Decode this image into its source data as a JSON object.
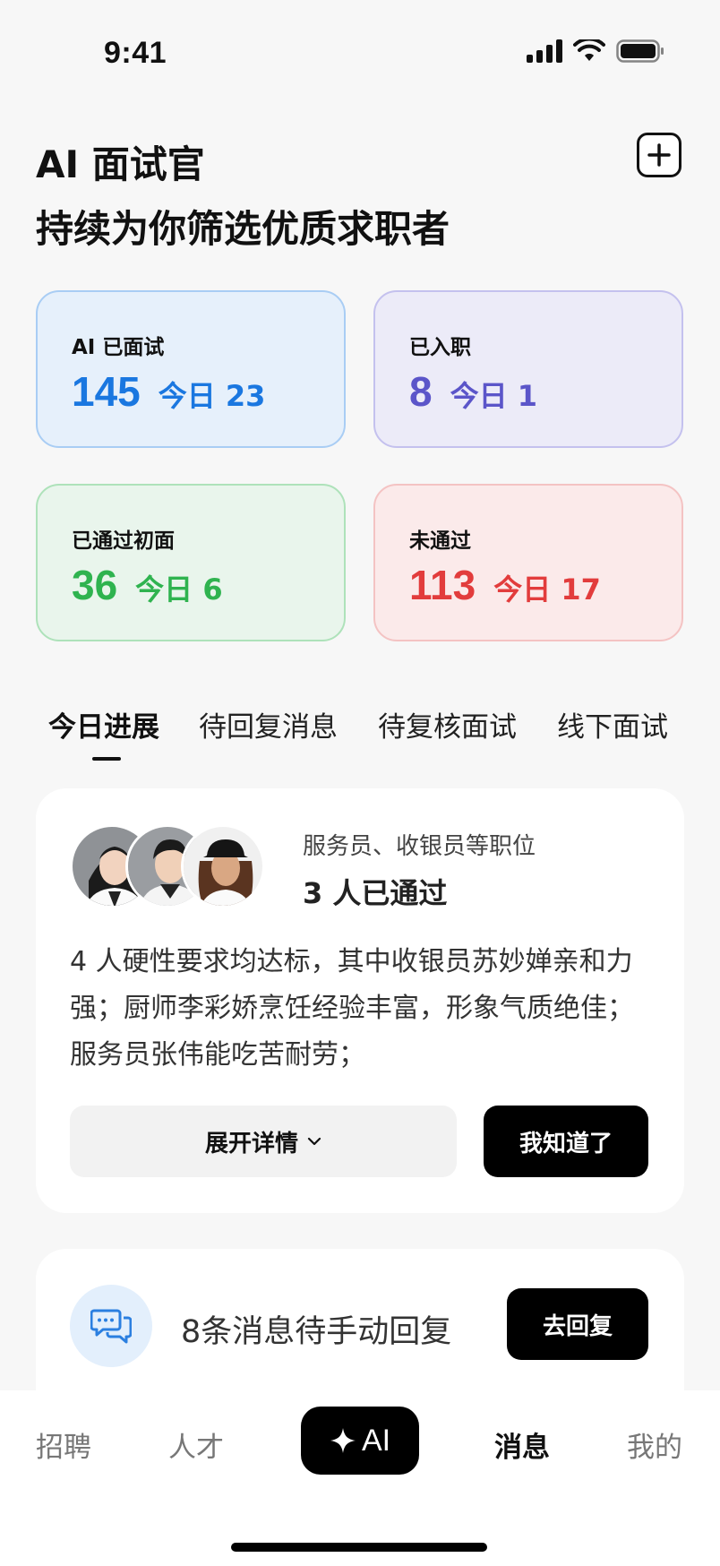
{
  "status_bar": {
    "time": "9:41"
  },
  "header": {
    "title": "AI 面试官",
    "subtitle": "持续为你筛选优质求职者"
  },
  "stats": [
    {
      "label": "AI 已面试",
      "value": "145",
      "today": "今日 23"
    },
    {
      "label": "已入职",
      "value": "8",
      "today": "今日 1"
    },
    {
      "label": "已通过初面",
      "value": "36",
      "today": "今日 6"
    },
    {
      "label": "未通过",
      "value": "113",
      "today": "今日 17"
    }
  ],
  "tabs": [
    {
      "label": "今日进展"
    },
    {
      "label": "待回复消息"
    },
    {
      "label": "待复核面试"
    },
    {
      "label": "线下面试"
    }
  ],
  "progress_card": {
    "position": "服务员、收银员等职位",
    "passed": "3 人已通过",
    "summary": "4 人硬性要求均达标，其中收银员苏妙婵亲和力强；厨师李彩娇烹饪经验丰富，形象气质绝佳；服务员张伟能吃苦耐劳；",
    "expand_label": "展开详情",
    "ack_label": "我知道了"
  },
  "message_card": {
    "text": "8条消息待手动回复",
    "reply_label": "去回复"
  },
  "bottom_nav": {
    "recruit": "招聘",
    "talent": "人才",
    "ai": "AI",
    "messages": "消息",
    "mine": "我的"
  },
  "colors": {
    "blue": "#1a77e0",
    "purple": "#5b55c9",
    "green": "#2fb34f",
    "red": "#e23c3c"
  }
}
